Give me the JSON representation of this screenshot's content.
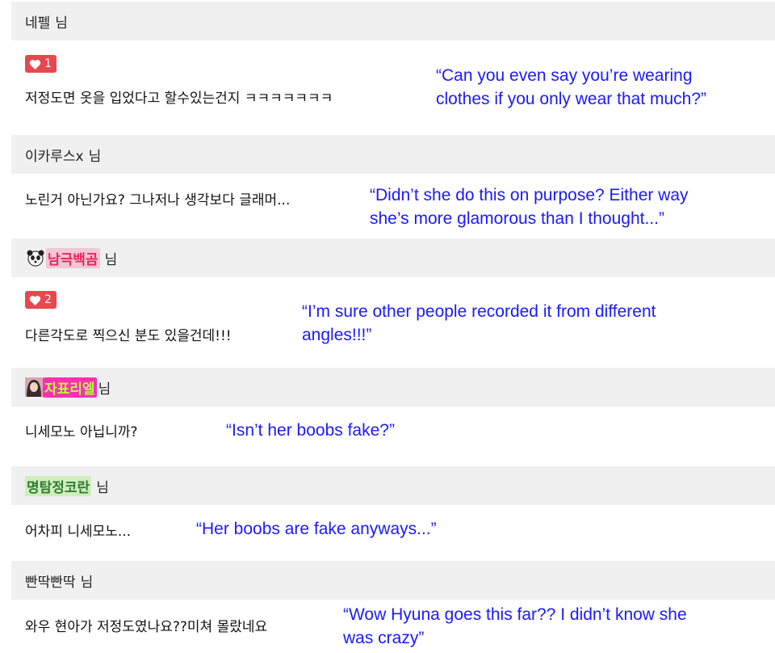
{
  "comments": [
    {
      "nickname": "네펠",
      "suffix": "님",
      "text": "저정도면 옷을 입었다고 할수있는건지 ㅋㅋㅋㅋㅋㅋㅋ",
      "likes": "1",
      "translation_line1": "“Can you even say you’re wearing",
      "translation_line2": "clothes if you only wear that much?”"
    },
    {
      "nickname": "이카루스x",
      "suffix": "님",
      "text": "노린거 아닌가요? 그나저나 생각보다 글래머...",
      "translation_line1": "“Didn’t she do this on purpose? Either way",
      "translation_line2": "she’s more glamorous than I thought...”"
    },
    {
      "nickname": "남극백곰",
      "suffix": "님",
      "text": "다른각도로 찍으신 분도 있을건데!!!",
      "likes": "2",
      "translation_line1": "“I’m sure other people recorded it from different",
      "translation_line2": "angles!!!”"
    },
    {
      "nickname": "자표리엘",
      "suffix": "님",
      "text": "니세모노 아닙니까?",
      "translation_line1": "“Isn’t her boobs fake?”"
    },
    {
      "nickname": "명탐정코란",
      "suffix": "님",
      "text": "어차피 니세모노...",
      "translation_line1": "“Her boobs are fake anyways...”"
    },
    {
      "nickname": "빤딱빤딱",
      "suffix": "님",
      "text": "와우 현아가 저정도였나요??미쳐 몰랐네요",
      "translation_line1": "“Wow Hyuna goes this far?? I didn’t know she",
      "translation_line2": "was crazy”"
    }
  ],
  "colors": {
    "header_bg": "#f0f0f0",
    "translation": "#1a1aff",
    "like_badge": "#e8474e",
    "nick3_bg": "#f2c6d4",
    "nick3_text": "#e8265d",
    "nick4_bg": "#ff2fb4",
    "nick4_text": "#b6ff3c",
    "nick5_bg": "#cfeec0",
    "nick5_text": "#2e7d2e"
  },
  "icons": {
    "like": "heart-icon",
    "avatar3": "panda-avatar-icon",
    "avatar4": "profile-photo-icon"
  }
}
